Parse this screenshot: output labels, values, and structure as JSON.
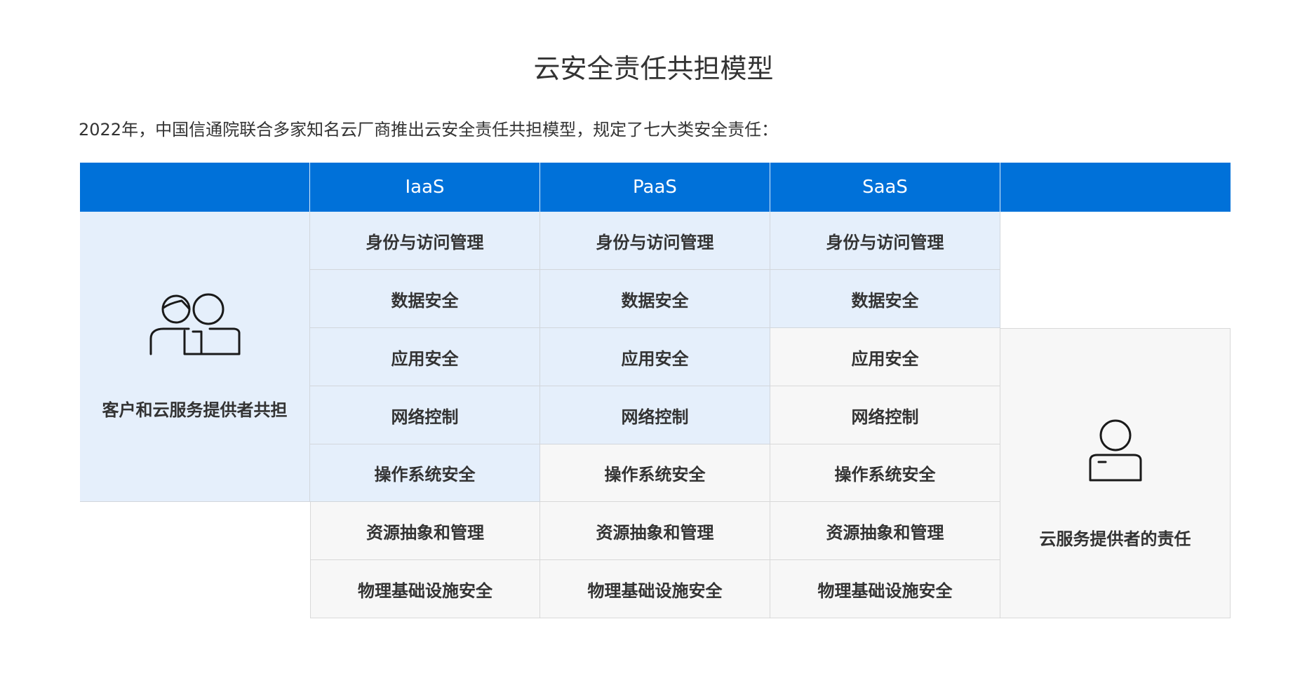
{
  "title": "云安全责任共担模型",
  "intro": "2022年，中国信通院联合多家知名云厂商推出云安全责任共担模型，规定了七大类安全责任：",
  "colors": {
    "header": "#0071d9",
    "shared_fill": "#e5effb",
    "provider_fill": "#f7f7f7"
  },
  "table": {
    "columns": [
      "",
      "IaaS",
      "PaaS",
      "SaaS",
      ""
    ],
    "rows": [
      {
        "IaaS": "身份与访问管理",
        "PaaS": "身份与访问管理",
        "SaaS": "身份与访问管理",
        "shared_count": 3
      },
      {
        "IaaS": "数据安全",
        "PaaS": "数据安全",
        "SaaS": "数据安全",
        "shared_count": 3
      },
      {
        "IaaS": "应用安全",
        "PaaS": "应用安全",
        "SaaS": "应用安全",
        "shared_count": 2
      },
      {
        "IaaS": "网络控制",
        "PaaS": "网络控制",
        "SaaS": "网络控制",
        "shared_count": 2
      },
      {
        "IaaS": "操作系统安全",
        "PaaS": "操作系统安全",
        "SaaS": "操作系统安全",
        "shared_count": 1
      },
      {
        "IaaS": "资源抽象和管理",
        "PaaS": "资源抽象和管理",
        "SaaS": "资源抽象和管理",
        "shared_count": 0
      },
      {
        "IaaS": "物理基础设施安全",
        "PaaS": "物理基础设施安全",
        "SaaS": "物理基础设施安全",
        "shared_count": 0
      }
    ]
  },
  "shared_label": "客户和云服务提供者共担",
  "shared_icon": "two-people-icon",
  "provider_label": "云服务提供者的责任",
  "provider_icon": "person-icon"
}
